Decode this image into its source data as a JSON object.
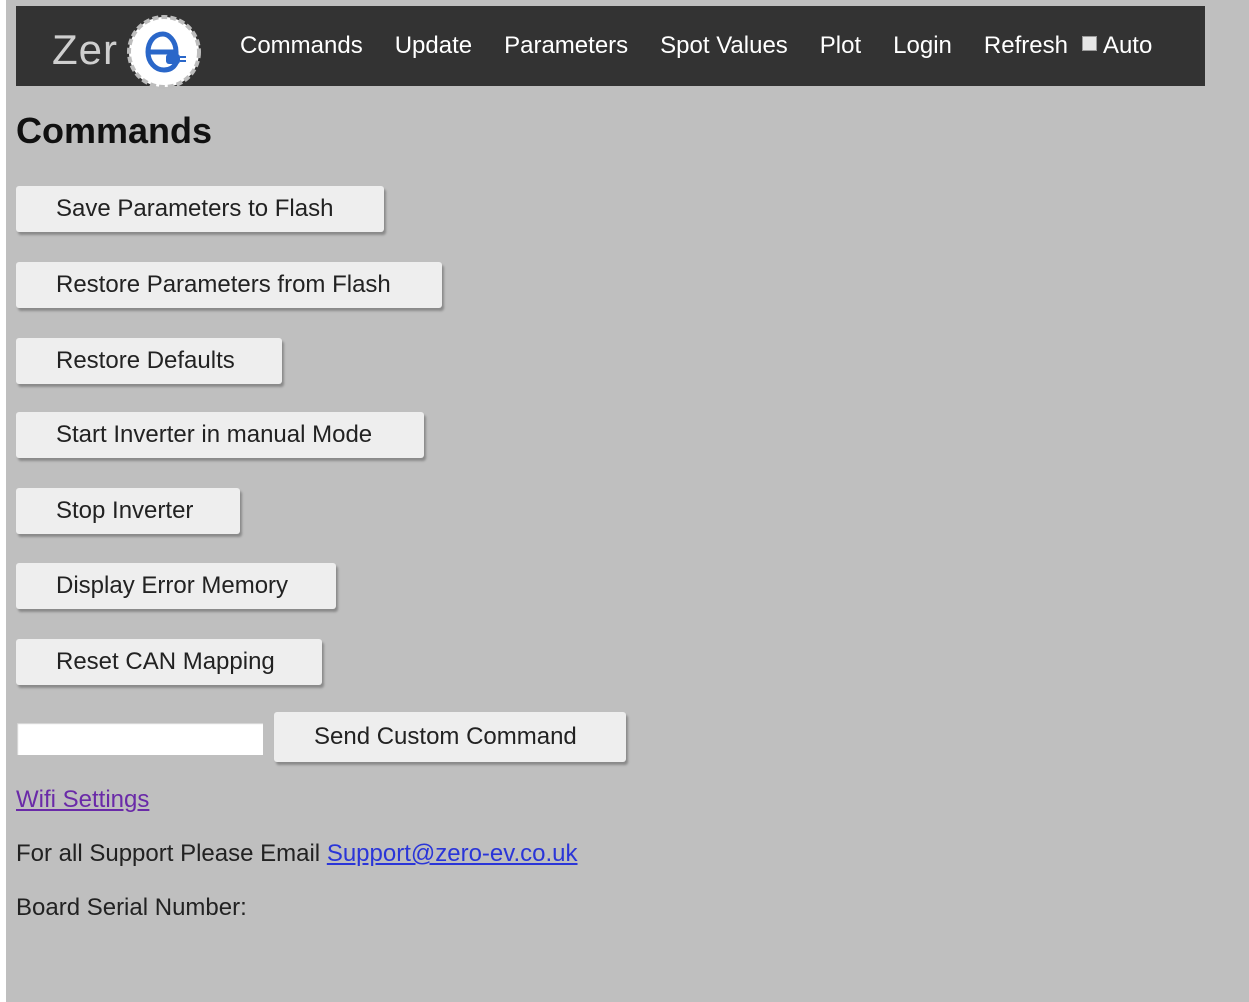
{
  "brand": {
    "logo_text": "Zer",
    "logo_badge_letter": "e",
    "logo_badge_sub": "⚡"
  },
  "nav": {
    "items": [
      {
        "label": "Commands"
      },
      {
        "label": "Update"
      },
      {
        "label": "Parameters"
      },
      {
        "label": "Spot Values"
      },
      {
        "label": "Plot"
      },
      {
        "label": "Login"
      },
      {
        "label": "Refresh"
      }
    ],
    "auto_label": "Auto",
    "auto_checked": false
  },
  "page": {
    "title": "Commands"
  },
  "commands": {
    "save_flash": "Save Parameters to Flash",
    "restore_flash": "Restore Parameters from Flash",
    "restore_defaults": "Restore Defaults",
    "start_manual": "Start Inverter in manual Mode",
    "stop_inverter": "Stop Inverter",
    "display_errors": "Display Error Memory",
    "reset_can": "Reset CAN Mapping",
    "custom_input_value": "",
    "send_custom": "Send Custom Command"
  },
  "footer": {
    "wifi_link": "Wifi Settings",
    "support_prefix": "For all Support Please Email ",
    "support_email": "Support@zero-ev.co.uk",
    "serial_label": "Board Serial Number:"
  },
  "colors": {
    "navbar_bg": "#333333",
    "page_bg": "#bfbfbf",
    "button_bg": "#eeeeee",
    "visited_link": "#6a2aa8",
    "link": "#2a35d8"
  }
}
